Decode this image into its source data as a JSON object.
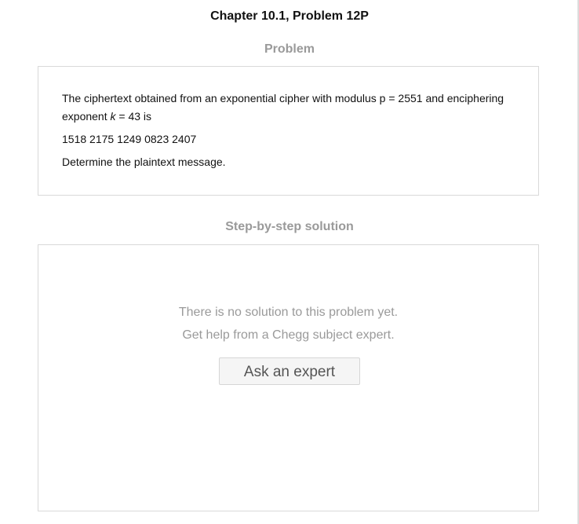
{
  "header": {
    "chapter_title": "Chapter 10.1, Problem 12P"
  },
  "problem": {
    "heading": "Problem",
    "line1_before_k": "The ciphertext obtained from an exponential cipher with modulus p = 2551 and enciphering exponent ",
    "k_symbol": "k",
    "line1_after_k": " = 43 is",
    "ciphertext": "1518 2175 1249 0823 2407",
    "instruction": "Determine the plaintext message."
  },
  "solution": {
    "heading": "Step-by-step solution",
    "empty_message_1": "There is no solution to this problem yet.",
    "empty_message_2": "Get help from a Chegg subject expert.",
    "ask_button_label": "Ask an expert"
  }
}
